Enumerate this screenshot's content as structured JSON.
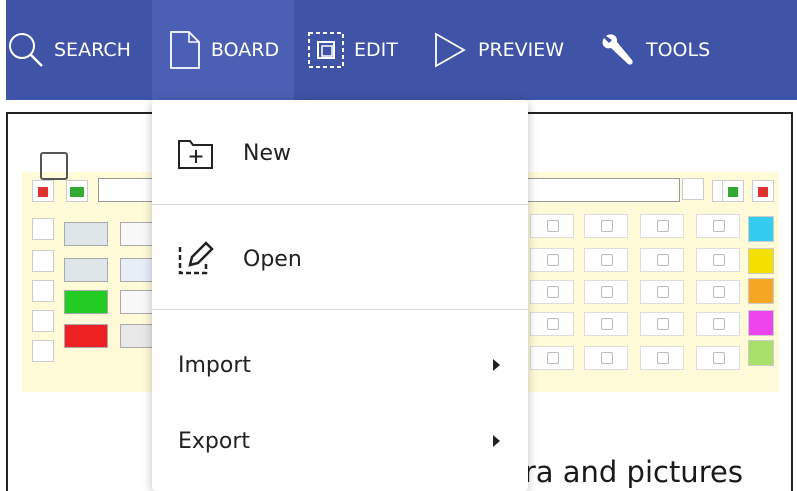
{
  "nav": {
    "items": [
      {
        "label": "SEARCH",
        "icon": "search-icon"
      },
      {
        "label": "BOARD",
        "icon": "board-page-icon"
      },
      {
        "label": "EDIT",
        "icon": "edit-select-icon"
      },
      {
        "label": "PREVIEW",
        "icon": "play-icon"
      },
      {
        "label": "TOOLS",
        "icon": "wrench-icon"
      }
    ],
    "active": "BOARD",
    "bg_color": "#3f53a7"
  },
  "menu": {
    "new_label": "New",
    "open_label": "Open",
    "import_label": "Import",
    "export_label": "Export"
  },
  "background_text": "era and pictures",
  "colors": {
    "board_bg": "#fffbd9",
    "green_tile": "#22cc22",
    "red_tile": "#ee2222",
    "yellow_tile": "#f4e000",
    "orange_tile": "#f5a623",
    "magenta_tile": "#ee44ee",
    "lightgreen_tile": "#a8e06a",
    "cyan_tile": "#33ccee"
  }
}
